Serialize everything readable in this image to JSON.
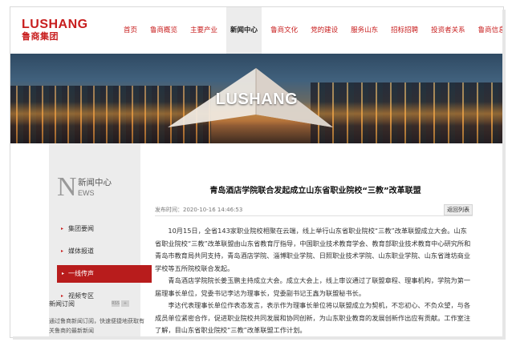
{
  "logo": {
    "en": "LUSHANG",
    "cn": "鲁商集团"
  },
  "nav": {
    "items": [
      "首页",
      "鲁商概览",
      "主要产业",
      "新闻中心",
      "鲁商文化",
      "党的建设",
      "服务山东",
      "招标招聘",
      "投资者关系",
      "鲁商信息"
    ],
    "active_index": 3
  },
  "banner": {
    "text": "LUSHANG"
  },
  "sidebar": {
    "letter": "N",
    "title_cn": "新闻中心",
    "title_en": "EWS",
    "items": [
      {
        "label": "集团要闻",
        "active": false
      },
      {
        "label": "媒体报道",
        "active": false
      },
      {
        "label": "一线传声",
        "active": true
      },
      {
        "label": "视频专区",
        "active": false
      }
    ],
    "subscribe": {
      "title": "新闻订阅",
      "text": "通过鲁商新闻订阅，快速便捷地获取有关鲁商的最新新闻"
    }
  },
  "article": {
    "title": "青岛酒店学院联合发起成立山东省职业院校“三教”改革联盟",
    "meta": "发布时间：2020-10-16 14:46:53",
    "back_label": "返回列表",
    "paragraphs": [
      "10月15日，全省143家职业院校相聚在云端，线上举行山东省职业院校“三教”改革联盟成立大会。山东省职业院校“三教”改革联盟由山东省教育厅指导，中国职业技术教育学会、教育部职业技术教育中心研究所和青岛市教育局共同支持，青岛酒店学院、淄博职业学院、日照职业技术学院、山东职业学院、山东省潍坊商业学校等五所院校联合发起。",
      "青岛酒店学院院长姜玉鹏主持成立大会。成立大会上，线上审议通过了联盟章程、理事机构，学院为第一届理事长单位，党委书记李达为理事长，党委副书记王鑫为联盟秘书长。",
      "李达代表理事长单位作表态发言，表示作为理事长单位将以联盟成立为契机，不忘初心、不负众望，与各成员单位紧密合作，促进职业院校共同发展和协同创新，为山东职业教育的发展创新作出应有贡献。工作室注了解，目山东省职业院校“三教”改革联盟工作计划。"
    ]
  },
  "colors": {
    "brand_red": "#c81e1e",
    "menu_active": "#b81c1c",
    "panel_gray": "#ececec"
  }
}
